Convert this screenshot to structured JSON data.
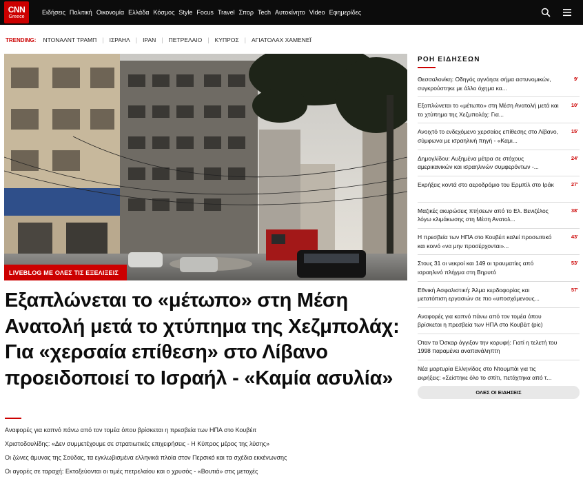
{
  "brand": {
    "logo_main": "CNN",
    "logo_sub": "Greece"
  },
  "nav": {
    "items": [
      "Ειδήσεις",
      "Πολιτική",
      "Οικονομία",
      "Ελλάδα",
      "Κόσμος",
      "Style",
      "Focus",
      "Travel",
      "Σπορ",
      "Tech",
      "Αυτοκίνητο",
      "Video",
      "Εφημερίδες"
    ]
  },
  "icons": {
    "search": "search-icon",
    "menu": "hamburger-menu-icon"
  },
  "trending": {
    "label": "TRENDING:",
    "items": [
      "ΝΤΟΝΑΛΝΤ ΤΡΑΜΠ",
      "ΙΣΡΑΗΛ",
      "ΙΡΑΝ",
      "ΠΕΤΡΕΛΑΙΟ",
      "ΚΥΠΡΟΣ",
      "ΑΓΙΑΤΟΛΑΧ ΧΑΜΕΝΕΪ"
    ]
  },
  "main": {
    "badge": "LIVEBLOG ΜΕ ΟΛΕΣ ΤΙΣ ΕΞΕΛΙΞΕΙΣ",
    "headline": "Εξαπλώνεται το «μέτωπο» στη Μέση Ανατολή μετά το χτύπημα της Χεζμπολάχ: Για «χερσαία επίθεση» στο Λίβανο προειδοποιεί το Ισραήλ - «Καμία ασυλία»",
    "related": [
      "Αναφορές για καπνό πάνω από τον τομέα όπου βρίσκεται η πρεσβεία των ΗΠΑ στο Κουβέιτ",
      "Χριστοδουλίδης: «Δεν συμμετέχουμε σε στρατιωτικές επιχειρήσεις - Η Κύπρος μέρος της λύσης»",
      "Οι ζώνες άμυνας της Σούδας, τα εγκλωβισμένα ελληνικά πλοία στον Περσικό και τα σχέδια εκκένωνσης",
      "Οι αγορές σε ταραχή: Εκτοξεύονται οι τιμές πετρελαίου και ο χρυσός - «Βουτιά» στις μετοχές"
    ]
  },
  "sidebar": {
    "title": "ΡΟΗ ΕΙΔΗΣΕΩΝ",
    "items": [
      {
        "text": "Θεσσαλονίκη: Οδηγός αγνόησε σήμα αστυνομικών, συγκρούστηκε με άλλο όχημα κα...",
        "time": "9'"
      },
      {
        "text": "Εξαπλώνεται το «μέτωπο» στη Μέση Ανατολή μετά και το χτύπημα της Χεζμπολάχ: Για...",
        "time": "10'"
      },
      {
        "text": "Ανοιχτό το ενδεχόμενο χερσαίας επίθεσης στο Λίβανο, σύμφωνα με ισραηλινή πηγή - «Καμι...",
        "time": "15'"
      },
      {
        "text": "Δημογλίδου: Αυξημένα μέτρα σε στόχους αμερικανικών και ισραηλινών συμφερόντων -...",
        "time": "24'"
      },
      {
        "text": "Εκρήξεις κοντά στο αεροδρόμιο του Ερμπίλ στο Ιράκ",
        "time": "27'"
      },
      {
        "text": "Μαζικές ακυρώσεις πτήσεων από το Ελ. Βενιζέλος λόγω κλιμάκωσης στη Μέση Ανατολ...",
        "time": "38'"
      },
      {
        "text": "Η πρεσβεία των ΗΠΑ στο Κουβέιτ καλεί προσωπικό και κοινό «να μην προσέρχονται»...",
        "time": "43'"
      },
      {
        "text": "Στους 31 οι νεκροί και 149 οι τραυματίες από ισραηλινό πλήγμα στη Βηρυτό",
        "time": "53'"
      },
      {
        "text": "Εθνική Ασφαλιστική: Άλμα κερδοφορίας και μετατόπιση εργασιών σε πιο «υποσχόμενους...",
        "time": "57'"
      },
      {
        "text": "Αναφορές για καπνό πάνω από τον τομέα όπου βρίσκεται η πρεσβεία των ΗΠΑ στο Κουβέιτ (pic)",
        "time": ""
      },
      {
        "text": "Όταν τα Όσκαρ άγγιξαν την κορυφή: Γιατί η τελετή του 1998 παραμένει αναπανάληπτη",
        "time": ""
      },
      {
        "text": "Νέα μαρτυρία Ελληνίδας στο Ντουμπάι για τις εκρήξεις: «Σείστηκε όλο το σπίτι, πετάχτηκα από τ...",
        "time": ""
      }
    ],
    "all_news_label": "ΟΛΕΣ ΟΙ ΕΙΔΗΣΕΙΣ"
  },
  "colors": {
    "brand_red": "#cc0000",
    "topbar": "#0c0c0c"
  }
}
